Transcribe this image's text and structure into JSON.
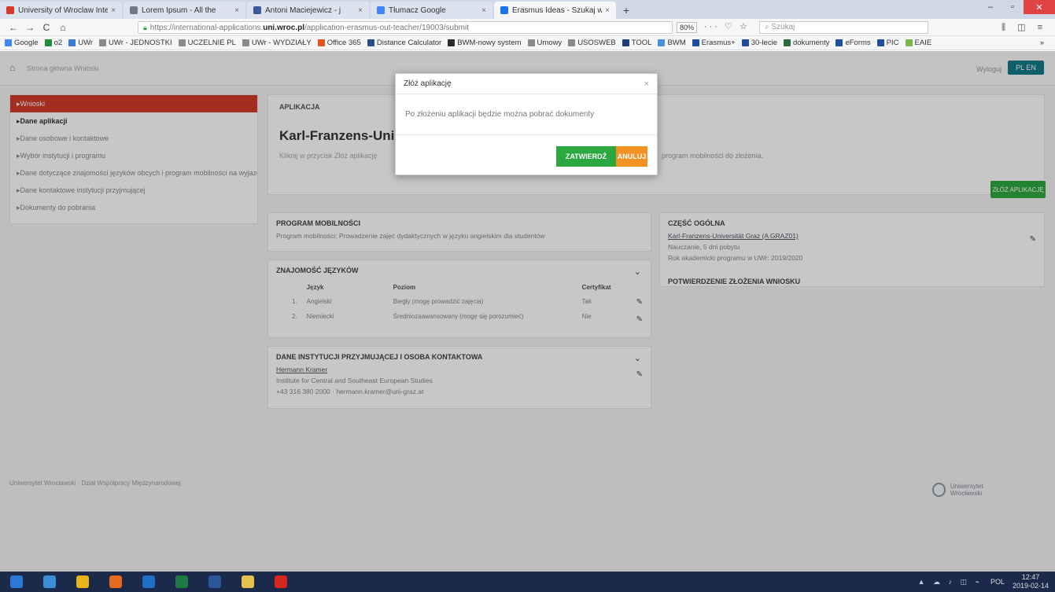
{
  "browser": {
    "tabs": [
      {
        "title": "University of Wroclaw Inter",
        "icon_color": "#d33a2c",
        "active": false
      },
      {
        "title": "Lorem Ipsum - All the",
        "icon_color": "#6c7a89",
        "active": false
      },
      {
        "title": "Antoni Maciejewicz - j",
        "icon_color": "#3b5998",
        "active": false
      },
      {
        "title": "Tłumacz Google",
        "icon_color": "#4285f4",
        "active": false
      },
      {
        "title": "Erasmus Ideas - Szukaj w",
        "icon_color": "#1a73e8",
        "active": true
      }
    ],
    "new_tab": "+",
    "window_controls": {
      "minimize": "–",
      "maximize": "▫",
      "close": "✕"
    },
    "nav": {
      "back": "←",
      "forward": "→",
      "reload": "C",
      "home": "⌂"
    },
    "url_prefix": "https://international-applications.",
    "url_domain": "uni.wroc.pl",
    "url_path": "/application-erasmus-out-teacher/19003/submit",
    "zoom": "80%",
    "page_actions": "··· ♡ ☆",
    "search_placeholder": "Szukaj",
    "toolbar_right": "⫼ ◫ ≡",
    "bookmarks": [
      {
        "label": "Google",
        "color": "#4285f4"
      },
      {
        "label": "o2",
        "color": "#1f8f3a"
      },
      {
        "label": "UWr",
        "color": "#3a7bd5"
      },
      {
        "label": "UWr - JEDNOSTKI",
        "color": "#8a8a8a"
      },
      {
        "label": "UCZELNIE PL",
        "color": "#8a8a8a"
      },
      {
        "label": "UWr - WYDZIAŁY",
        "color": "#8a8a8a"
      },
      {
        "label": "Office 365",
        "color": "#e2571e"
      },
      {
        "label": "Distance Calculator",
        "color": "#2b4b8c"
      },
      {
        "label": "BWM-nowy system",
        "color": "#2a2a2a"
      },
      {
        "label": "Umowy",
        "color": "#8a8a8a"
      },
      {
        "label": "USOSWEB",
        "color": "#8a8a8a"
      },
      {
        "label": "TOOL",
        "color": "#1c3f7c"
      },
      {
        "label": "BWM",
        "color": "#4a90d9"
      },
      {
        "label": "Erasmus+",
        "color": "#1f4e9c"
      },
      {
        "label": "30-lecie",
        "color": "#1f4e9c"
      },
      {
        "label": "dokumenty",
        "color": "#2d6a3d"
      },
      {
        "label": "eForms",
        "color": "#1f4e9c"
      },
      {
        "label": "PIC",
        "color": "#1f4e9c"
      },
      {
        "label": "EAIE",
        "color": "#7ab648"
      }
    ],
    "bookmarks_more": "»"
  },
  "app": {
    "nav_links": "Strona główna    Wnioski",
    "user": "Wyloguj",
    "lang_button": "PL  EN",
    "sidebar": [
      {
        "label": "Wnioski",
        "state": "active"
      },
      {
        "label": "Dane aplikacji",
        "state": "current"
      },
      {
        "label": "Dane osobowe i kontaktowe",
        "state": ""
      },
      {
        "label": "Wybór instytucji i programu",
        "state": ""
      },
      {
        "label": "Dane dotyczące znajomości języków obcych i program mobilności na wyjazd",
        "state": ""
      },
      {
        "label": "Dane kontaktowe instytucji przyjmującej",
        "state": ""
      },
      {
        "label": "Dokumenty do pobrania",
        "state": ""
      }
    ],
    "breadcrumb": "APLIKACJA",
    "title": "Karl-Franzens-Uni",
    "desc_left": "Kliknij w przycisk Złóż aplikację",
    "desc_right": "program mobilności do złożenia.",
    "submit_button": "ZŁÓŻ APLIKACJĘ",
    "program_panel": {
      "title": "PROGRAM MOBILNOŚCI",
      "text": "Program mobilności: Prowadzenie zajęć dydaktycznych w języku angielskim dla studentów"
    },
    "lang_panel": {
      "title": "ZNAJOMOŚĆ JĘZYKÓW",
      "headers": [
        "Język",
        "Poziom",
        "Certyfikat"
      ],
      "rows": [
        {
          "n": "1.",
          "lang": "Angielski",
          "level": "Biegły (mogę prowadzić zajęcia)",
          "cert": "Tak"
        },
        {
          "n": "2.",
          "lang": "Niemiecki",
          "level": "Średniozaawansowany (mogę się porozumieć)",
          "cert": "Nie"
        }
      ]
    },
    "contact_panel": {
      "title": "DANE INSTYTUCJI PRZYJMUJĄCEJ I OSOBA KONTAKTOWA",
      "name": "Hermann Kramer",
      "line1": "Institute for Central and Southeast European Studies",
      "line2": "+43 316 380 2000 · hermann.kramer@uni-graz.at"
    },
    "side_panel": {
      "title": "CZĘŚĆ OGÓLNA",
      "link": "Karl-Franzens-Universität Graz (A GRAZ01)",
      "line1": "Nauczanie, 5 dni pobytu",
      "line2": "Rok akademicki programu w UWr: 2019/2020",
      "title2": "POTWIERDZENIE ZŁOŻENIA WNIOSKU"
    },
    "footer_left": "Uniwersytet Wrocławski · Dział Współpracy Międzynarodowej",
    "footer_logo": "Uniwersytet Wrocławski"
  },
  "modal": {
    "title": "Złóż aplikację",
    "close": "×",
    "body": "Po złożeniu aplikacji będzie można pobrać dokumenty",
    "confirm": "ZATWIERDŹ",
    "cancel": "ANULUJ"
  },
  "taskbar": {
    "apps": [
      {
        "name": "windows-start",
        "color": "#2a79d6"
      },
      {
        "name": "internet-explorer",
        "color": "#3b8fd9"
      },
      {
        "name": "chrome",
        "color": "#e8b21a"
      },
      {
        "name": "firefox",
        "color": "#e66b1f"
      },
      {
        "name": "outlook",
        "color": "#1f6fc4"
      },
      {
        "name": "excel",
        "color": "#1e7a44"
      },
      {
        "name": "word",
        "color": "#2b579a"
      },
      {
        "name": "file-explorer",
        "color": "#e7c14b"
      },
      {
        "name": "acrobat",
        "color": "#d5271c"
      }
    ],
    "tray_icons": "▲ ☁ ♪ ◫ ⌁",
    "lang": "POL",
    "time": "12:47",
    "date": "2019-02-14"
  }
}
